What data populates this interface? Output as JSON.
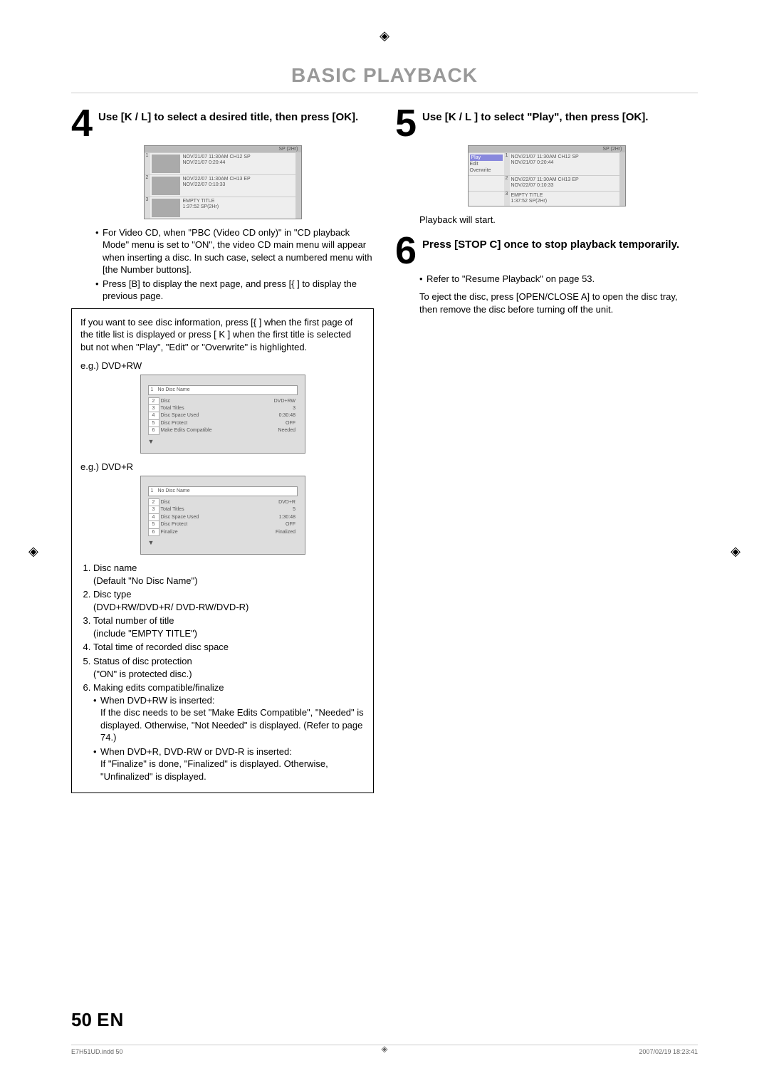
{
  "title": "BASIC PLAYBACK",
  "step4": {
    "num": "4",
    "head_a": "Use [",
    "head_b": "K / L",
    "head_c": "] to select a desired title, then press [OK].",
    "osd": {
      "topbar": "SP (2Hr)",
      "rows": [
        {
          "idx": "1",
          "l1": "NOV/21/07  11:30AM CH12  SP",
          "l2": "NOV/21/07   0:20:44"
        },
        {
          "idx": "2",
          "l1": "NOV/22/07  11:30AM CH13  EP",
          "l2": "NOV/22/07   0:10:33"
        },
        {
          "idx": "3",
          "l1": "EMPTY TITLE",
          "l2": "1:37:52  SP(2Hr)"
        }
      ]
    },
    "bullets": [
      "For Video CD, when \"PBC (Video CD only)\" in \"CD playback Mode\" menu is set to \"ON\", the video CD main menu will appear when inserting a disc. In such case, select a numbered menu with [the Number buttons].",
      "Press [B] to display the next page, and press [{ ] to display the previous page."
    ]
  },
  "infobox": {
    "intro": "If you want to see disc information, press [{   ] when the first page of the title list is displayed or press [ K ] when the first title is selected but not when \"Play\", \"Edit\" or \"Overwrite\" is highlighted.",
    "eg1_label": "e.g.) DVD+RW",
    "eg2_label": "e.g.) DVD+R",
    "disc1": {
      "name_idx": "1",
      "name": "No Disc Name",
      "rows": [
        {
          "k": "2",
          "l": "Disc",
          "r": "DVD+RW"
        },
        {
          "k": "3",
          "l": "Total Titles",
          "r": "3"
        },
        {
          "k": "4",
          "l": "Disc Space Used",
          "r": "0:30:48"
        },
        {
          "k": "5",
          "l": "Disc Protect",
          "r": "OFF"
        },
        {
          "k": "6",
          "l": "Make Edits Compatible",
          "r": "Needed"
        }
      ]
    },
    "disc2": {
      "name_idx": "1",
      "name": "No Disc Name",
      "rows": [
        {
          "k": "2",
          "l": "Disc",
          "r": "DVD+R"
        },
        {
          "k": "3",
          "l": "Total Titles",
          "r": "5"
        },
        {
          "k": "4",
          "l": "Disc Space Used",
          "r": "1:30:48"
        },
        {
          "k": "5",
          "l": "Disc Protect",
          "r": "OFF"
        },
        {
          "k": "6",
          "l": "Finalize",
          "r": "Finalized"
        }
      ]
    },
    "legend": [
      {
        "t": "Disc name",
        "s": [
          "Default \"No Disc Name\")"
        ],
        "prefix": "("
      },
      {
        "t": "Disc type",
        "s": [
          "(DVD+RW/DVD+R/ DVD-RW/DVD-R)"
        ]
      },
      {
        "t": "Total number of title",
        "s": [
          "include \"EMPTY TITLE\")"
        ],
        "prefix": "("
      },
      {
        "t": "Total time of recorded disc space"
      },
      {
        "t": "Status of disc protection",
        "s": [
          "(\"ON\" is protected disc.)"
        ]
      },
      {
        "t": "Making edits compatible/finalize",
        "sub": [
          "When DVD+RW is inserted:\nIf the disc needs to be set \"Make Edits Compatible\", \"Needed\" is displayed. Otherwise, \"Not Needed\" is displayed. (Refer to page 74.)",
          "When DVD+R, DVD-RW or DVD-R is inserted:\nIf \"Finalize\" is done, \"Finalized\"  is displayed. Otherwise, \"Unfinalized\" is displayed."
        ]
      }
    ]
  },
  "step5": {
    "num": "5",
    "head": "Use [K / L ] to select \"Play\", then press [OK].",
    "osd": {
      "topbar": "SP (2Hr)",
      "menu": [
        "Play",
        "Edit",
        "Overwrite"
      ],
      "rows": [
        {
          "idx": "1",
          "l1": "NOV/21/07  11:30AM CH12  SP",
          "l2": "NOV/21/07   0:20:44"
        },
        {
          "idx": "2",
          "l1": "NOV/22/07  11:30AM CH13  EP",
          "l2": "NOV/22/07   0:10:33"
        },
        {
          "idx": "3",
          "l1": "EMPTY TITLE",
          "l2": "1:37:52  SP(2Hr)"
        }
      ]
    },
    "after": "Playback will start."
  },
  "step6": {
    "num": "6",
    "head": "Press [STOP C] once to stop playback temporarily.",
    "bullet": "Refer to \"Resume Playback\" on page 53.",
    "body": "To eject the disc, press [OPEN/CLOSE A] to open the disc tray, then remove the disc before turning off the unit."
  },
  "footer": {
    "page": "50",
    "lang": "EN"
  },
  "printmeta": {
    "left": "E7H51UD.indd   50",
    "right": "2007/02/19   18:23:41"
  }
}
